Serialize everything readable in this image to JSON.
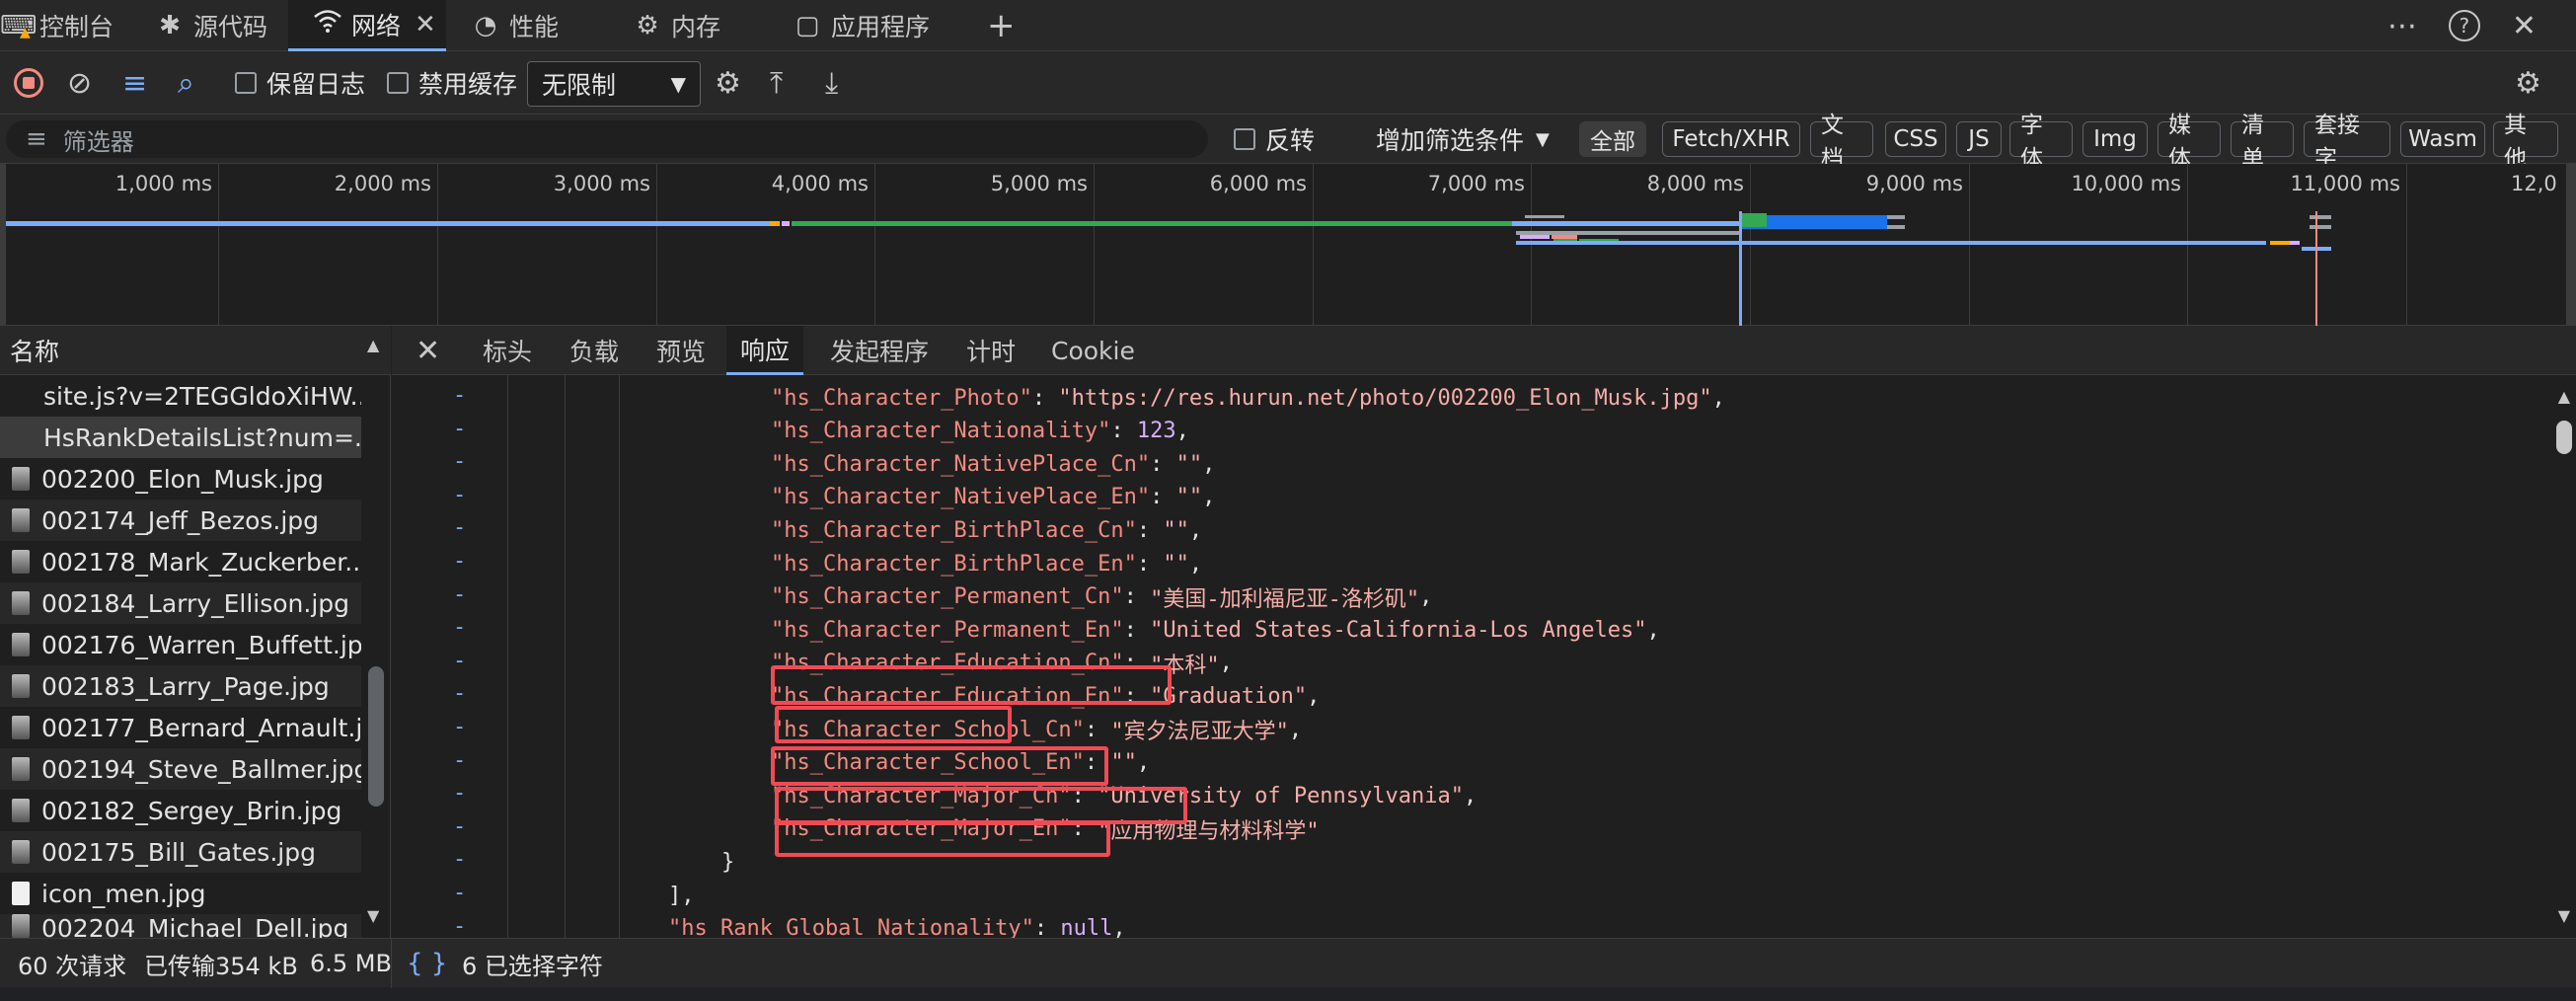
{
  "tabs": [
    {
      "label": "控制台",
      "icon": "console-icon"
    },
    {
      "label": "源代码",
      "icon": "bug-icon"
    },
    {
      "label": "网络",
      "icon": "wifi-icon",
      "active": true
    },
    {
      "label": "性能",
      "icon": "performance-icon"
    },
    {
      "label": "内存",
      "icon": "memory-icon"
    },
    {
      "label": "应用程序",
      "icon": "application-icon"
    }
  ],
  "toolbar": {
    "preserve_log": "保留日志",
    "disable_cache": "禁用缓存",
    "throttle": "无限制"
  },
  "filterbar": {
    "placeholder": "筛选器",
    "invert": "反转",
    "more_filters": "增加筛选条件",
    "chips": [
      "全部",
      "Fetch/XHR",
      "文档",
      "CSS",
      "JS",
      "字体",
      "Img",
      "媒体",
      "清单",
      "套接字",
      "Wasm",
      "其他"
    ]
  },
  "timeline": {
    "ticks": [
      "1,000 ms",
      "2,000 ms",
      "3,000 ms",
      "4,000 ms",
      "5,000 ms",
      "6,000 ms",
      "7,000 ms",
      "8,000 ms",
      "9,000 ms",
      "10,000 ms",
      "11,000 ms",
      "12,0"
    ]
  },
  "requests": {
    "header": "名称",
    "items": [
      "site.js?v=2TEGGldoXiHW...",
      "HsRankDetailsList?num=...",
      "002200_Elon_Musk.jpg",
      "002174_Jeff_Bezos.jpg",
      "002178_Mark_Zuckerber...",
      "002184_Larry_Ellison.jpg",
      "002176_Warren_Buffett.jpg",
      "002183_Larry_Page.jpg",
      "002177_Bernard_Arnault.j...",
      "002194_Steve_Ballmer.jpg",
      "002182_Sergey_Brin.jpg",
      "002175_Bill_Gates.jpg",
      "icon_men.jpg",
      "002204_Michael_Dell.jpg"
    ]
  },
  "subtabs": [
    "标头",
    "负载",
    "预览",
    "响应",
    "发起程序",
    "计时",
    "Cookie"
  ],
  "response": {
    "lines": [
      {
        "key": "\"hs_Character_Photo\"",
        "value": "\"https://res.hurun.net/photo/002200_Elon_Musk.jpg\"",
        "type": "s",
        "comma": true
      },
      {
        "key": "\"hs_Character_Nationality\"",
        "value": "123",
        "type": "n",
        "comma": true
      },
      {
        "key": "\"hs_Character_NativePlace_Cn\"",
        "value": "\"\"",
        "type": "s",
        "comma": true
      },
      {
        "key": "\"hs_Character_NativePlace_En\"",
        "value": "\"\"",
        "type": "s",
        "comma": true
      },
      {
        "key": "\"hs_Character_BirthPlace_Cn\"",
        "value": "\"\"",
        "type": "s",
        "comma": true
      },
      {
        "key": "\"hs_Character_BirthPlace_En\"",
        "value": "\"\"",
        "type": "s",
        "comma": true
      },
      {
        "key": "\"hs_Character_Permanent_Cn\"",
        "value": "\"美国-加利福尼亚-洛杉矶\"",
        "type": "s",
        "comma": true
      },
      {
        "key": "\"hs_Character_Permanent_En\"",
        "value": "\"United States-California-Los Angeles\"",
        "type": "s",
        "comma": true
      },
      {
        "key": "\"hs_Character_Education_Cn\"",
        "value": "\"本科\"",
        "type": "s",
        "comma": true
      },
      {
        "key": "\"hs_Character_Education_En\"",
        "value": "\"Graduation\"",
        "type": "s",
        "comma": true
      },
      {
        "key": "\"hs_Character_School_Cn\"",
        "value": "\"宾夕法尼亚大学\"",
        "type": "s",
        "comma": true
      },
      {
        "key": "\"hs_Character_School_En\"",
        "value": "\"\"",
        "type": "s",
        "comma": true
      },
      {
        "key": "\"hs_Character_Major_Cn\"",
        "value": "\"University of Pennsylvania\"",
        "type": "s",
        "comma": true
      },
      {
        "key": "\"hs_Character_Major_En\"",
        "value": "\"应用物理与材料科学\"",
        "type": "s",
        "comma": false
      }
    ],
    "close_brace": "}",
    "close_bracket": "],",
    "global_key": "\"hs_Rank_Global_Nationality\"",
    "global_value": "null"
  },
  "status": {
    "requests": "60 次请求",
    "transferred": "已传输354 kB",
    "resources": "6.5 MB",
    "pretty_print": "{ }",
    "selection": "6 已选择字符"
  },
  "colors": {
    "accent": "#7cacf8",
    "highlight_box": "#f04b55",
    "json_key": "#f28b82",
    "json_number": "#d7aefb"
  }
}
